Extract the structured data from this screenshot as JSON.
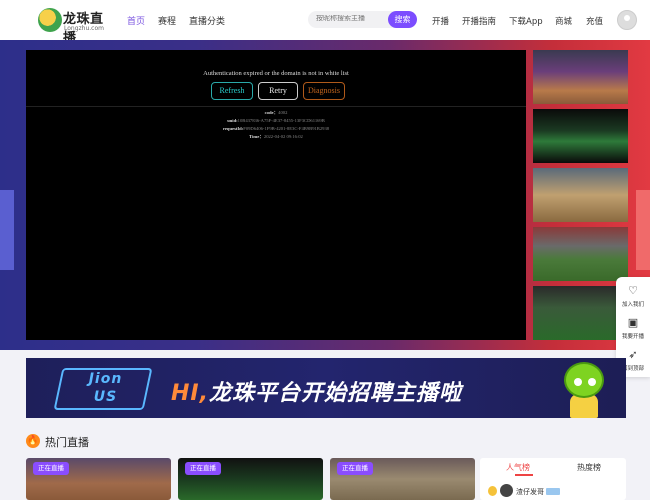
{
  "header": {
    "logo_cn": "龙珠直播",
    "logo_en": "Longzhu.com",
    "nav": [
      {
        "label": "首页",
        "active": true
      },
      {
        "label": "赛程",
        "active": false
      },
      {
        "label": "直播分类",
        "active": false
      }
    ],
    "search": {
      "placeholder": "按昵称搜索主播",
      "button_label": "搜索"
    },
    "links": [
      "开播",
      "开播指南",
      "下载App",
      "商城",
      "充值"
    ]
  },
  "player": {
    "error_message": "Authentication expired or the domain is not in white list",
    "buttons": {
      "refresh": "Refresh",
      "retry": "Retry",
      "diagnosis": "Diagnosis"
    },
    "info": {
      "code_label": "code：",
      "code_value": "4002",
      "uuid_label": "uuid:",
      "uuid_value": "10B437836-A75F-4E37-8455-13F3CD61169B",
      "requestid_label": "requestId:",
      "requestid_value": "F09D6406-1F9B-4201-8E3C-F4B9B91B2938",
      "time_label": "Time：",
      "time_value": "2022-04-02 09:16:02"
    }
  },
  "float_bar": {
    "items": [
      {
        "label": "加入我们",
        "icon": "heart-handshake-icon"
      },
      {
        "label": "我要开播",
        "icon": "tv-icon"
      },
      {
        "label": "回到顶部",
        "icon": "rocket-icon"
      }
    ]
  },
  "banner": {
    "join_line1": "Jion",
    "join_line2": "US",
    "title_hi": "HI,",
    "title_rest": "龙珠平台开始招聘主播啦"
  },
  "hot_live": {
    "title": "热门直播",
    "cards": [
      {
        "badge": "正在直播"
      },
      {
        "badge": "正在直播"
      },
      {
        "badge": "正在直播"
      }
    ]
  },
  "ranking": {
    "tabs": [
      "人气榜",
      "热度榜"
    ],
    "active_tab": 0,
    "top_entry": {
      "name": "渣仔发哥"
    }
  },
  "colors": {
    "accent": "#7c4dff",
    "live_badge": "#8a4dff",
    "rank_active": "#ee4444"
  }
}
